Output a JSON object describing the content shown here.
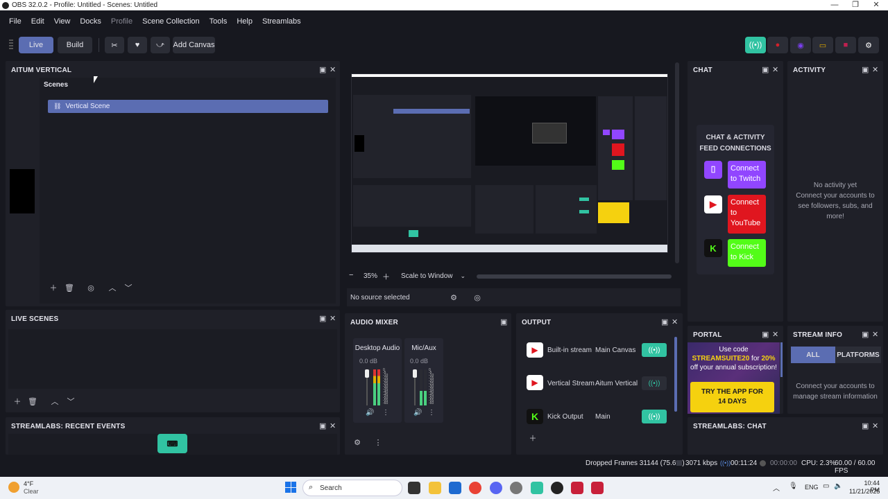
{
  "window": {
    "title": "OBS 32.0.2 - Profile: Untitled - Scenes: Untitled"
  },
  "menu": [
    "File",
    "Edit",
    "View",
    "Docks",
    "Profile",
    "Scene Collection",
    "Tools",
    "Help",
    "Streamlabs"
  ],
  "toolbar": {
    "live": "Live",
    "build": "Build",
    "add_canvas": "Add Canvas"
  },
  "scenes_dock": {
    "title": "AITUM VERTICAL",
    "scenes_label": "Scenes",
    "scene_item": "Vertical Scene"
  },
  "preview": {
    "zoom": "35%",
    "scale_mode": "Scale to Window",
    "no_source": "No source selected"
  },
  "chat": {
    "title": "CHAT",
    "feed_title": "CHAT & ACTIVITY\nFEED CONNECTIONS",
    "connect_twitch": "Connect\nto Twitch",
    "connect_youtube": "Connect\nto\nYouTube",
    "connect_kick": "Connect\nto Kick"
  },
  "activity": {
    "title": "ACTIVITY",
    "empty": "No activity yet\nConnect your accounts to see followers, subs, and more!"
  },
  "live_scenes": {
    "title": "LIVE SCENES"
  },
  "recent_events": {
    "title": "STREAMLABS: RECENT EVENTS"
  },
  "audio_mixer": {
    "title": "AUDIO MIXER",
    "channels": [
      {
        "name": "Desktop Audio",
        "db": "0.0 dB"
      },
      {
        "name": "Mic/Aux",
        "db": "0.0 dB"
      }
    ],
    "scale": [
      "0",
      "-5",
      "-10",
      "-15",
      "-20",
      "-25",
      "-30",
      "-35",
      "-40",
      "-45",
      "-50",
      "-55",
      "-60"
    ]
  },
  "output": {
    "title": "OUTPUT",
    "rows": [
      {
        "name": "Built-in stream",
        "canvas": "Main Canvas",
        "active": true
      },
      {
        "name": "Vertical Stream",
        "canvas": "Aitum Vertical",
        "active": false
      },
      {
        "name": "Kick Output",
        "canvas": "Main",
        "active": true
      }
    ]
  },
  "portal": {
    "title": "PORTAL",
    "promo_pre": "Use code ",
    "promo_code": "STREAMSUITE20",
    "promo_mid": " for ",
    "promo_pct": "20%",
    "promo_post": " off your annual subscription!",
    "cta": "TRY THE APP FOR\n14 DAYS"
  },
  "stream_info": {
    "title": "STREAM INFO",
    "tab_all": "ALL",
    "tab_platforms": "PLATFORMS",
    "message": "Connect your accounts to manage stream information"
  },
  "sl_chat": {
    "title": "STREAMLABS: CHAT"
  },
  "status": {
    "dropped": "Dropped Frames 31144 (75.6%)",
    "bitrate": "3071 kbps",
    "live_time": "00:11:24",
    "rec_time": "00:00:00",
    "cpu": "CPU: 2.3%",
    "fps": "60.00 / 60.00 FPS"
  },
  "taskbar": {
    "temp": "4°F",
    "weather": "Clear",
    "search": "Search",
    "lang": "ENG",
    "time": "10:44 PM",
    "date": "11/21/2025"
  },
  "colors": {
    "accent": "#31c3a2",
    "twitch": "#9146ff",
    "youtube": "#e0161f",
    "kick": "#53fc18",
    "portal_gold": "#f5d10f",
    "live_btn": "#5b6db2"
  }
}
